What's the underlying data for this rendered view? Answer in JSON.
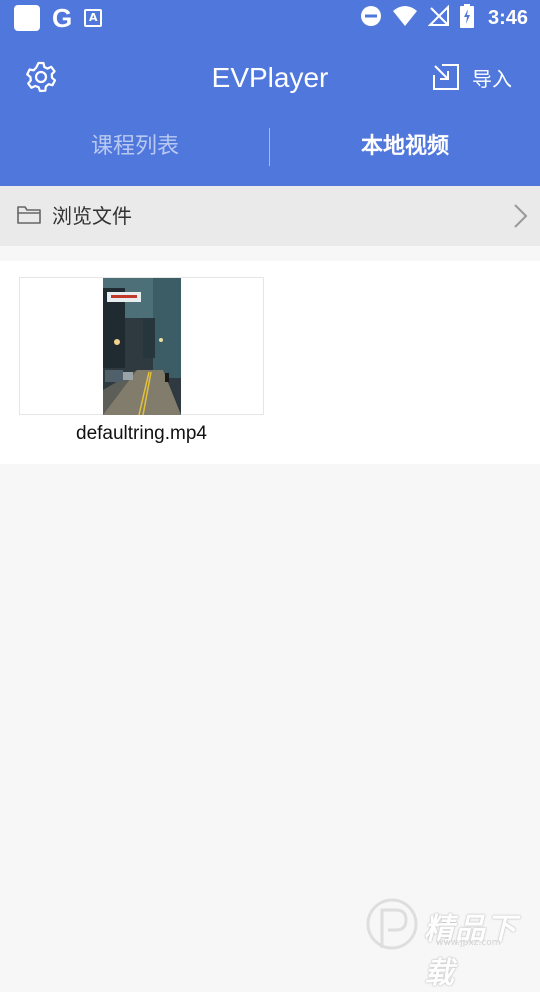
{
  "status_bar": {
    "time": "3:46",
    "left_icons": [
      "notification-square-icon",
      "google-icon",
      "keyboard-a-icon"
    ],
    "right_icons": [
      "do-not-disturb-icon",
      "wifi-icon",
      "no-signal-icon",
      "battery-charging-icon"
    ],
    "google_glyph": "G",
    "keyboard_glyph": "A"
  },
  "toolbar": {
    "title": "EVPlayer",
    "import_label": "导入",
    "settings_icon": "gear-icon",
    "import_icon": "import-arrow-icon"
  },
  "tabs": [
    {
      "label": "课程列表",
      "active": false
    },
    {
      "label": "本地视频",
      "active": true
    }
  ],
  "browse": {
    "label": "浏览文件",
    "icon": "folder-icon"
  },
  "videos": [
    {
      "name": "defaultring.mp4"
    }
  ],
  "colors": {
    "primary": "#5077dc",
    "background": "#f7f7f7",
    "browse_bar": "#eaeaea"
  }
}
